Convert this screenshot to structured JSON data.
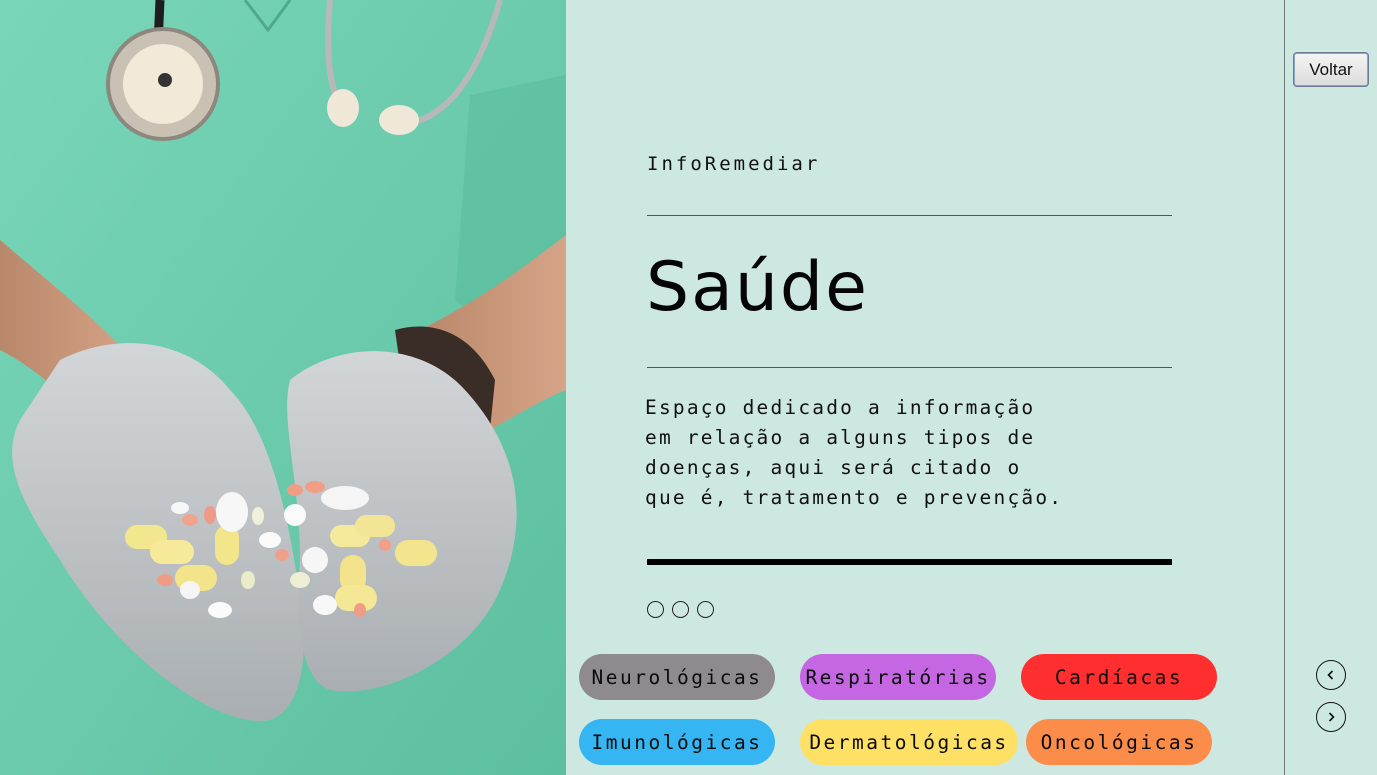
{
  "brand": "InfoRemediar",
  "title": "Saúde",
  "description": "Espaço dedicado a informação em relação a alguns tipos de doenças, aqui será citado o que é, tratamento e prevenção.",
  "carousel_dots": 3,
  "categories": [
    {
      "label": "Neurológicas",
      "color": "#8f8a8d"
    },
    {
      "label": "Respiratórias",
      "color": "#c566e3"
    },
    {
      "label": "Cardíacas",
      "color": "#ff2f2f"
    },
    {
      "label": "Imunológicas",
      "color": "#35b6f2"
    },
    {
      "label": "Dermatológicas",
      "color": "#fde064"
    },
    {
      "label": "Oncológicas",
      "color": "#fb8c49"
    }
  ],
  "nav": {
    "back_label": "Voltar",
    "prev_icon": "chevron-left-icon",
    "next_icon": "chevron-right-icon"
  },
  "colors": {
    "background": "#cde8e1",
    "photo_scrubs": "#6fcdb0"
  }
}
